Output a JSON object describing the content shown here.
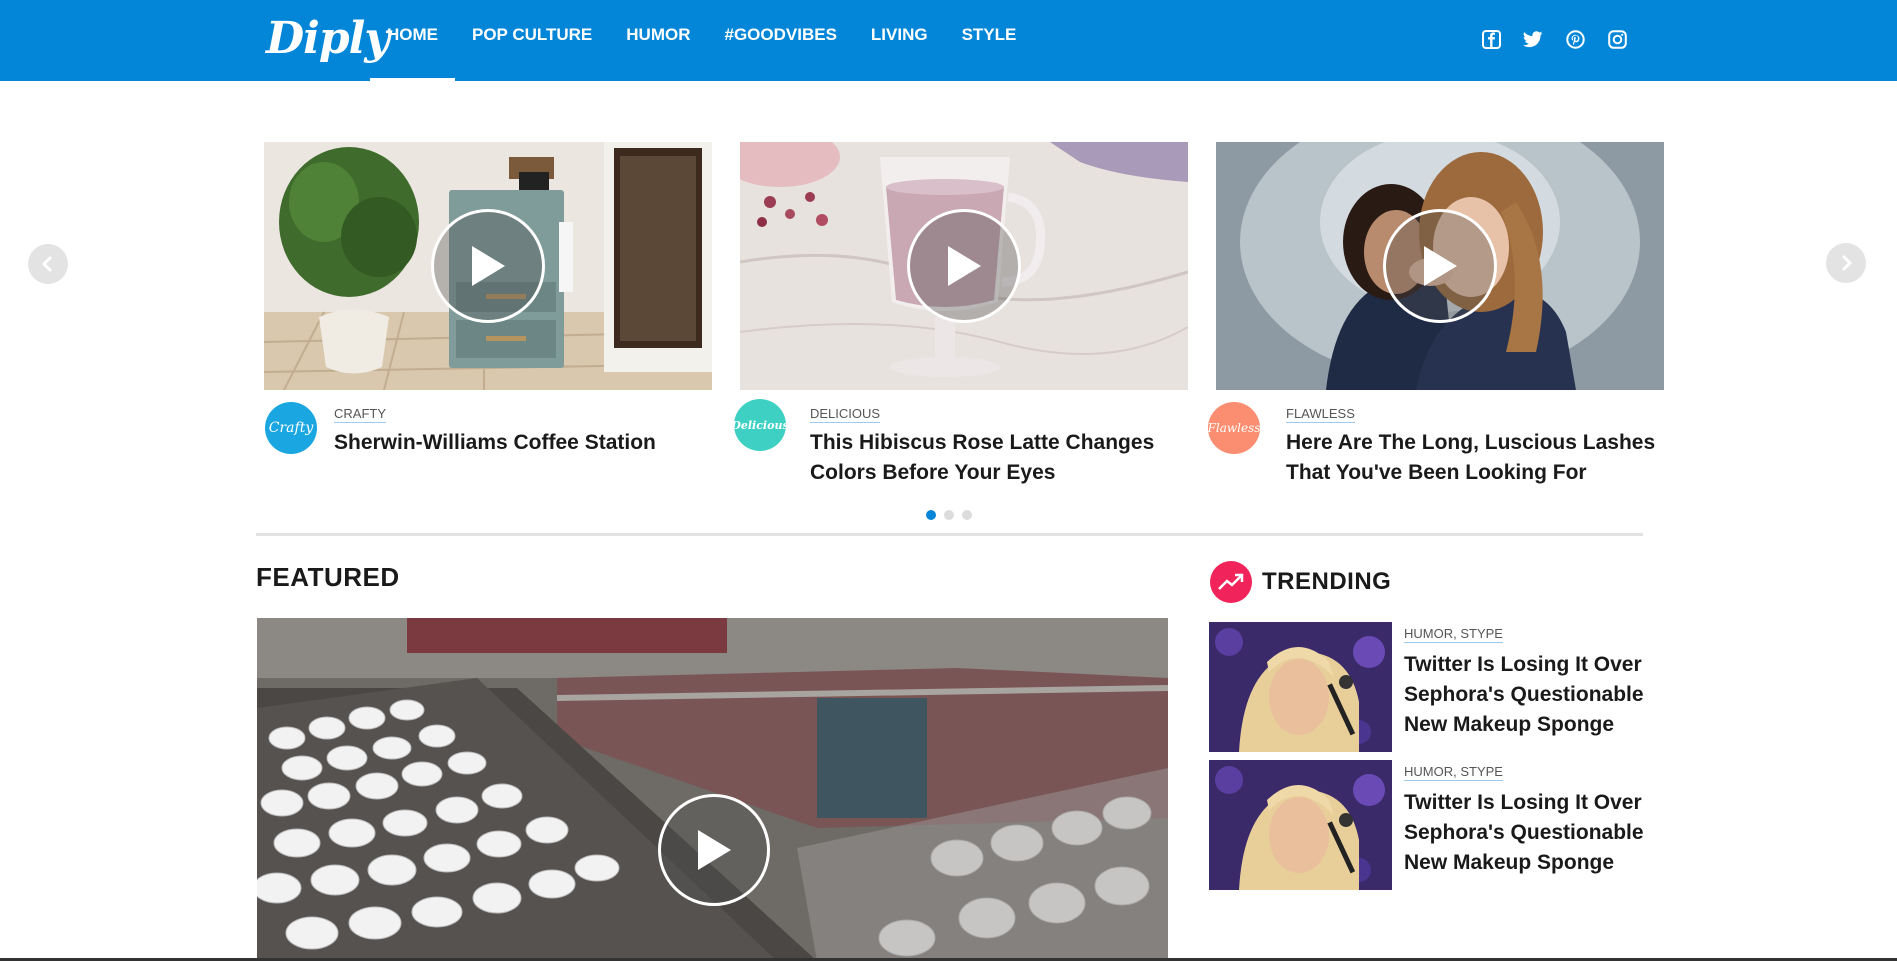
{
  "site": {
    "logo": "Diply"
  },
  "nav": {
    "items": [
      {
        "label": "HOME",
        "active": true
      },
      {
        "label": "POP CULTURE"
      },
      {
        "label": "HUMOR"
      },
      {
        "label": "#GOODVIBES"
      },
      {
        "label": "LIVING"
      },
      {
        "label": "STYLE"
      }
    ]
  },
  "social": [
    "facebook-icon",
    "twitter-icon",
    "pinterest-icon",
    "instagram-icon"
  ],
  "carousel": {
    "cards": [
      {
        "badge": "Crafty",
        "badge_color": "#1aa6e0",
        "category": "CRAFTY",
        "title_line1": "Sherwin-Williams Coffee Station",
        "title_line2": ""
      },
      {
        "badge": "Delicious",
        "badge_color": "#3ed1c3",
        "category": "DELICIOUS",
        "title_line1": "This Hibiscus Rose Latte Changes",
        "title_line2": "Colors Before Your Eyes"
      },
      {
        "badge": "Flawless",
        "badge_color": "#fb8e70",
        "category": "FLAWLESS",
        "title_line1": "Here Are The Long, Luscious Lashes",
        "title_line2": "That You've Been Looking For"
      }
    ],
    "pages": 3,
    "current_page": 1
  },
  "featured": {
    "heading": "FEATURED"
  },
  "trending": {
    "heading": "TRENDING",
    "items": [
      {
        "category": "HUMOR, STYPE",
        "line1": "Twitter Is Losing It Over",
        "line2": "Sephora's Questionable",
        "line3": "New Makeup Sponge"
      },
      {
        "category": "HUMOR, STYPE",
        "line1": "Twitter Is Losing It Over",
        "line2": "Sephora's Questionable",
        "line3": "New Makeup Sponge"
      }
    ]
  },
  "colors": {
    "brand": "#0386d8",
    "trending": "#f0245a",
    "dot_inactive": "#dcdcdc"
  }
}
